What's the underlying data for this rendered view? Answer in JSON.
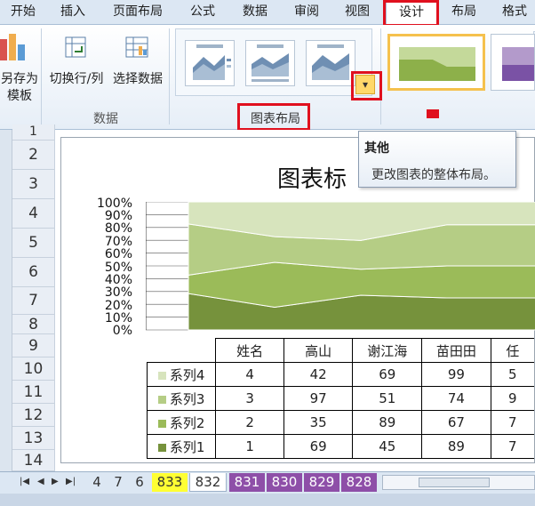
{
  "tabs": [
    "开始",
    "插入",
    "页面布局",
    "公式",
    "数据",
    "审阅",
    "视图",
    "设计",
    "布局",
    "格式"
  ],
  "active_tab": "设计",
  "ribbon": {
    "save_template_label_1": "另存为",
    "save_template_label_2": "模板",
    "switch_row_col_label": "切换行/列",
    "select_data_label": "选择数据",
    "data_group_label": "数据",
    "chart_layout_group_label": "图表布局",
    "more_button_glyph": "▾"
  },
  "tooltip": {
    "title": "其他",
    "body": "更改图表的整体布局。"
  },
  "row_numbers": [
    "1",
    "2",
    "3",
    "4",
    "5",
    "6",
    "7",
    "8",
    "9",
    "10",
    "11",
    "12",
    "13",
    "14"
  ],
  "colors": {
    "series1": "#76923c",
    "series2": "#9bbb59",
    "series3": "#b5cd85",
    "series4": "#d7e4bd",
    "highlight": "#e0101e",
    "tab_yellow": "#ffff33",
    "tab_purple": "#8e4fa8"
  },
  "chart_data": {
    "type": "area",
    "stacked": "percent",
    "title": "图表标",
    "categories": [
      "姓名",
      "高山",
      "谢江海",
      "苗田田",
      "任"
    ],
    "yticks": [
      "0%",
      "10%",
      "20%",
      "30%",
      "40%",
      "50%",
      "60%",
      "70%",
      "80%",
      "90%",
      "100%"
    ],
    "ylim": [
      0,
      1
    ],
    "grid": true,
    "series": [
      {
        "name": "系列4",
        "values": [
          "4",
          "42",
          "69",
          "99",
          "5"
        ]
      },
      {
        "name": "系列3",
        "values": [
          "3",
          "97",
          "51",
          "74",
          "9"
        ]
      },
      {
        "name": "系列2",
        "values": [
          "2",
          "35",
          "89",
          "67",
          "7"
        ]
      },
      {
        "name": "系列1",
        "values": [
          "1",
          "69",
          "45",
          "89",
          "7"
        ]
      }
    ]
  },
  "sheet_tabs": [
    "4",
    "7",
    "6",
    "833",
    "832",
    "831",
    "830",
    "829",
    "828"
  ],
  "active_sheet": "832"
}
